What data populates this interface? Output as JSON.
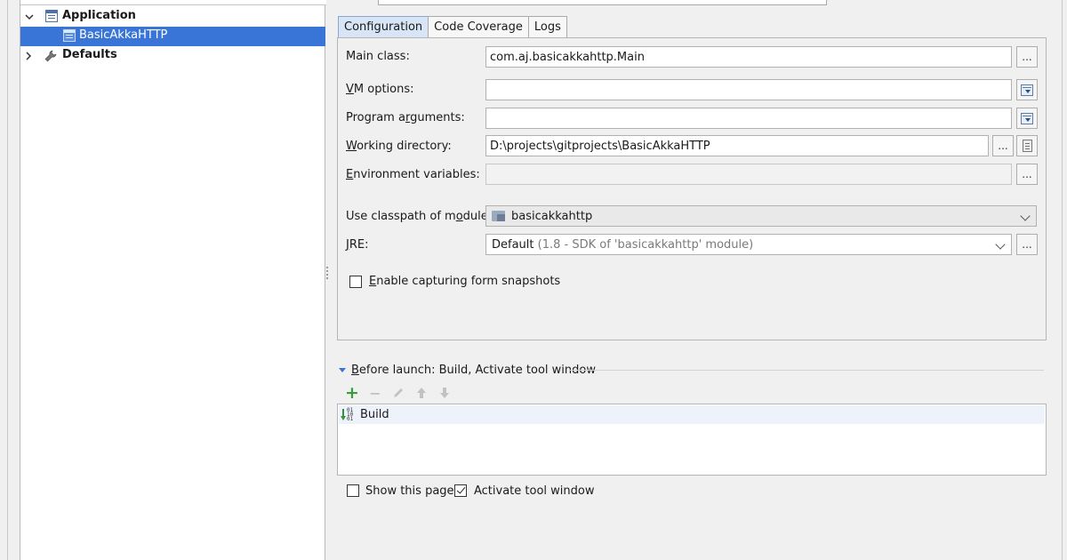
{
  "tree": {
    "application_label": "Application",
    "config_item_label": "BasicAkkaHTTP",
    "defaults_label": "Defaults"
  },
  "tabs": [
    {
      "label": "Configuration",
      "active": true
    },
    {
      "label": "Code Coverage",
      "active": false
    },
    {
      "label": "Logs",
      "active": false
    }
  ],
  "form": {
    "main_class_label": "Main class:",
    "main_class_value": "com.aj.basicakkahttp.Main",
    "vm_options_label_pre": "",
    "vm_options_label_u": "V",
    "vm_options_label_post": "M options:",
    "vm_options_value": "",
    "program_args_label_pre": "Program a",
    "program_args_label_u": "r",
    "program_args_label_post": "guments:",
    "program_args_value": "",
    "working_dir_label_pre": "",
    "working_dir_label_u": "W",
    "working_dir_label_post": "orking directory:",
    "working_dir_value": "D:\\projects\\gitprojects\\BasicAkkaHTTP",
    "env_vars_label_pre": "",
    "env_vars_label_u": "E",
    "env_vars_label_post": "nvironment variables:",
    "env_vars_value": "",
    "classpath_label_pre": "Use classpath of m",
    "classpath_label_u": "o",
    "classpath_label_post": "dule:",
    "classpath_value": "basicakkahttp",
    "jre_label_pre": "",
    "jre_label_u": "J",
    "jre_label_post": "RE:",
    "jre_value": "Default",
    "jre_hint": "(1.8 - SDK of 'basicakkahttp' module)",
    "snapshots_label_pre": "",
    "snapshots_label_u": "E",
    "snapshots_label_post": "nable capturing form snapshots",
    "snapshots_checked": false,
    "browse_label": "..."
  },
  "before_launch": {
    "header_pre": "",
    "header_u": "B",
    "header_post": "efore launch: Build, Activate tool window",
    "toolbar": [
      "add-icon",
      "remove-icon",
      "edit-icon",
      "move-up-icon",
      "move-down-icon"
    ],
    "items": [
      {
        "label": "Build",
        "icon": "build-icon"
      }
    ]
  },
  "options": {
    "show_page_label": "Show this page",
    "show_page_checked": false,
    "activate_tool_label": "Activate tool window",
    "activate_tool_checked": true
  },
  "colors": {
    "selection": "#3875d7",
    "active_tab": "#d7e5f7",
    "add_green": "#3b9a3b"
  }
}
